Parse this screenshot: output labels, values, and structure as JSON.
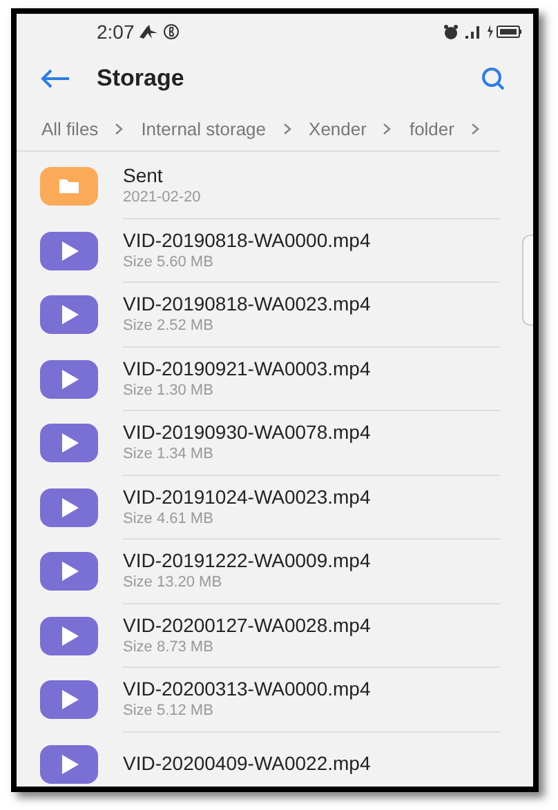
{
  "status_bar": {
    "time": "2:07"
  },
  "header": {
    "title": "Storage"
  },
  "breadcrumb": [
    "All files",
    "Internal storage",
    "Xender",
    "folder"
  ],
  "files": [
    {
      "kind": "folder",
      "name": "Sent",
      "detail": "2021-02-20"
    },
    {
      "kind": "video",
      "name": "VID-20190818-WA0000.mp4",
      "detail": "Size 5.60 MB"
    },
    {
      "kind": "video",
      "name": "VID-20190818-WA0023.mp4",
      "detail": "Size 2.52 MB"
    },
    {
      "kind": "video",
      "name": "VID-20190921-WA0003.mp4",
      "detail": "Size 1.30 MB"
    },
    {
      "kind": "video",
      "name": "VID-20190930-WA0078.mp4",
      "detail": "Size 1.34 MB"
    },
    {
      "kind": "video",
      "name": "VID-20191024-WA0023.mp4",
      "detail": "Size 4.61 MB"
    },
    {
      "kind": "video",
      "name": "VID-20191222-WA0009.mp4",
      "detail": "Size 13.20 MB"
    },
    {
      "kind": "video",
      "name": "VID-20200127-WA0028.mp4",
      "detail": "Size 8.73 MB"
    },
    {
      "kind": "video",
      "name": "VID-20200313-WA0000.mp4",
      "detail": "Size 5.12 MB"
    },
    {
      "kind": "video",
      "name": "VID-20200409-WA0022.mp4"
    }
  ]
}
